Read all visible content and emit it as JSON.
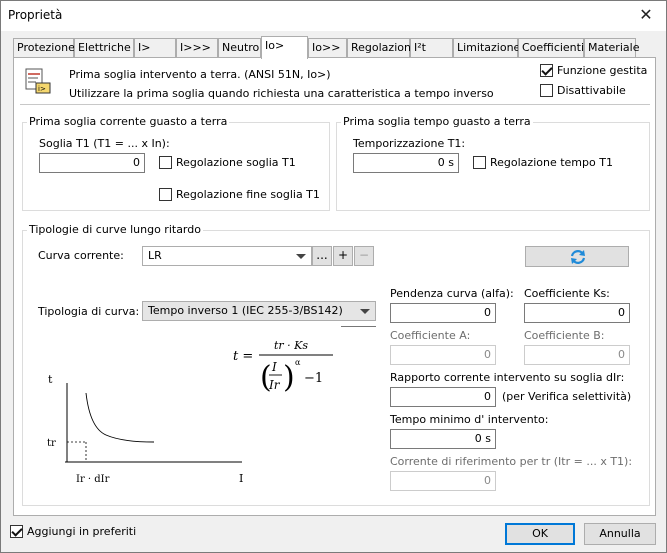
{
  "window": {
    "title": "Proprietà",
    "close_glyph": "✕"
  },
  "tabs": [
    {
      "label": "Protezione"
    },
    {
      "label": "Elettriche"
    },
    {
      "label": "I>"
    },
    {
      "label": "I>>>"
    },
    {
      "label": "Neutro"
    },
    {
      "label": "Io>",
      "active": true
    },
    {
      "label": "Io>>"
    },
    {
      "label": "Regolazioni"
    },
    {
      "label": "I²t"
    },
    {
      "label": "Limitazione"
    },
    {
      "label": "Coefficienti"
    },
    {
      "label": "Materiale"
    }
  ],
  "header": {
    "icon": "earth-fault-relay-icon",
    "line1": "Prima soglia intervento a terra. (ANSI 51N, Io>)",
    "line2": "Utilizzare la prima soglia quando richiesta una caratteristica a tempo inverso",
    "managed_label": "Funzione gestita",
    "managed_checked": true,
    "disableable_label": "Disattivabile",
    "disableable_checked": false
  },
  "current_group": {
    "title": "Prima soglia corrente guasto a terra",
    "threshold_label": "Soglia T1 (T1 = ... x In):",
    "threshold_value": "0",
    "reg_threshold_label": "Regolazione soglia T1",
    "reg_threshold_checked": false,
    "fine_reg_label": "Regolazione fine soglia T1",
    "fine_reg_checked": false
  },
  "time_group": {
    "title": "Prima soglia tempo guasto a terra",
    "delay_label": "Temporizzazione T1:",
    "delay_value": "0 s",
    "reg_time_label": "Regolazione tempo T1",
    "reg_time_checked": false
  },
  "curves_group": {
    "title": "Tipologie di curve lungo ritardo",
    "current_curve_label": "Curva corrente:",
    "current_curve_value": "LR",
    "more_button": "...",
    "add_button": "+",
    "remove_button": "−",
    "refresh_icon": "refresh-icon",
    "curve_type_label": "Tipologia di curva:",
    "curve_type_value": "Tempo inverso 1 (IEC 255-3/BS142)",
    "slope_label": "Pendenza curva (alfa):",
    "slope_value": "0",
    "ks_label": "Coefficiente Ks:",
    "ks_value": "0",
    "coef_a_label": "Coefficiente A:",
    "coef_a_value": "0",
    "coef_b_label": "Coefficiente B:",
    "coef_b_value": "0",
    "ratio_label": "Rapporto corrente intervento su soglia dIr:",
    "ratio_value": "0",
    "ratio_note": "(per Verifica selettività)",
    "min_time_label": "Tempo minimo d' intervento:",
    "min_time_value": "0 s",
    "ref_current_label": "Corrente di riferimento per tr (Itr = ... x T1):",
    "ref_current_value": "0",
    "formula": {
      "lhs": "t =",
      "numerator": "tr · Ks",
      "inner_num": "I",
      "inner_den": "Ir",
      "exponent": "α",
      "minus": "−1"
    },
    "graph": {
      "y_axis": "t",
      "y_mark": "tr",
      "x_mark": "Ir · dIr",
      "x_axis": "I",
      "corner_mark": ","
    }
  },
  "footer": {
    "favorites_label": "Aggiungi in preferiti",
    "favorites_checked": true,
    "ok_label": "OK",
    "cancel_label": "Annulla"
  }
}
